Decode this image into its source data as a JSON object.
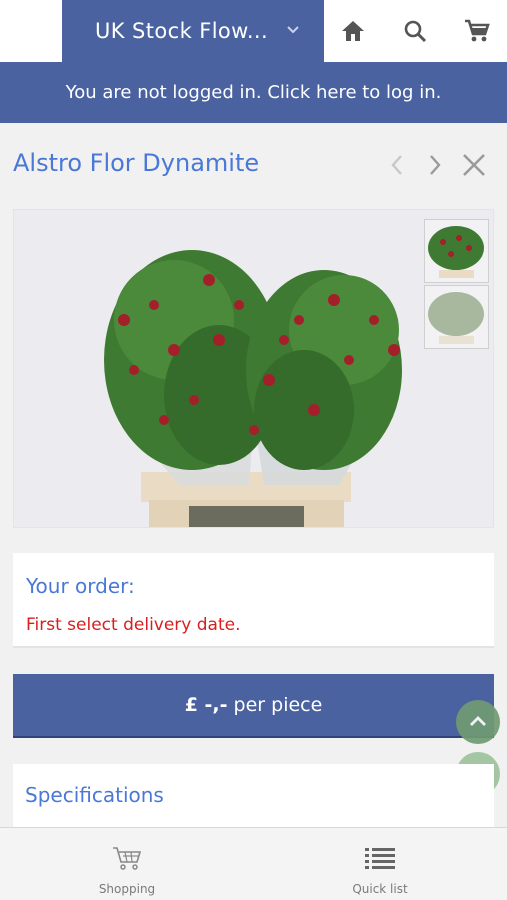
{
  "header": {
    "store_name": "UK Stock Flow...",
    "icons": [
      "home-icon",
      "search-icon",
      "cart-icon"
    ]
  },
  "login_banner": "You are not logged in. Click here to log in.",
  "product": {
    "title": "Alstro Flor Dynamite",
    "nav_icons": [
      "prev-arrow-icon",
      "next-arrow-icon",
      "close-icon"
    ]
  },
  "order": {
    "title": "Your order:",
    "warning": "First select delivery date."
  },
  "price": {
    "value": "£ -,-",
    "unit": "per piece"
  },
  "specifications": {
    "title": "Specifications"
  },
  "bottom_nav": {
    "items": [
      {
        "label": "Shopping",
        "icon": "shopping-cart-icon"
      },
      {
        "label": "Quick list",
        "icon": "list-icon"
      }
    ]
  },
  "colors": {
    "primary": "#4a62a0",
    "link": "#4a78d6",
    "warning": "#d81e1e",
    "float_up": "#6f9b72",
    "float_top": "#9dc29c"
  }
}
